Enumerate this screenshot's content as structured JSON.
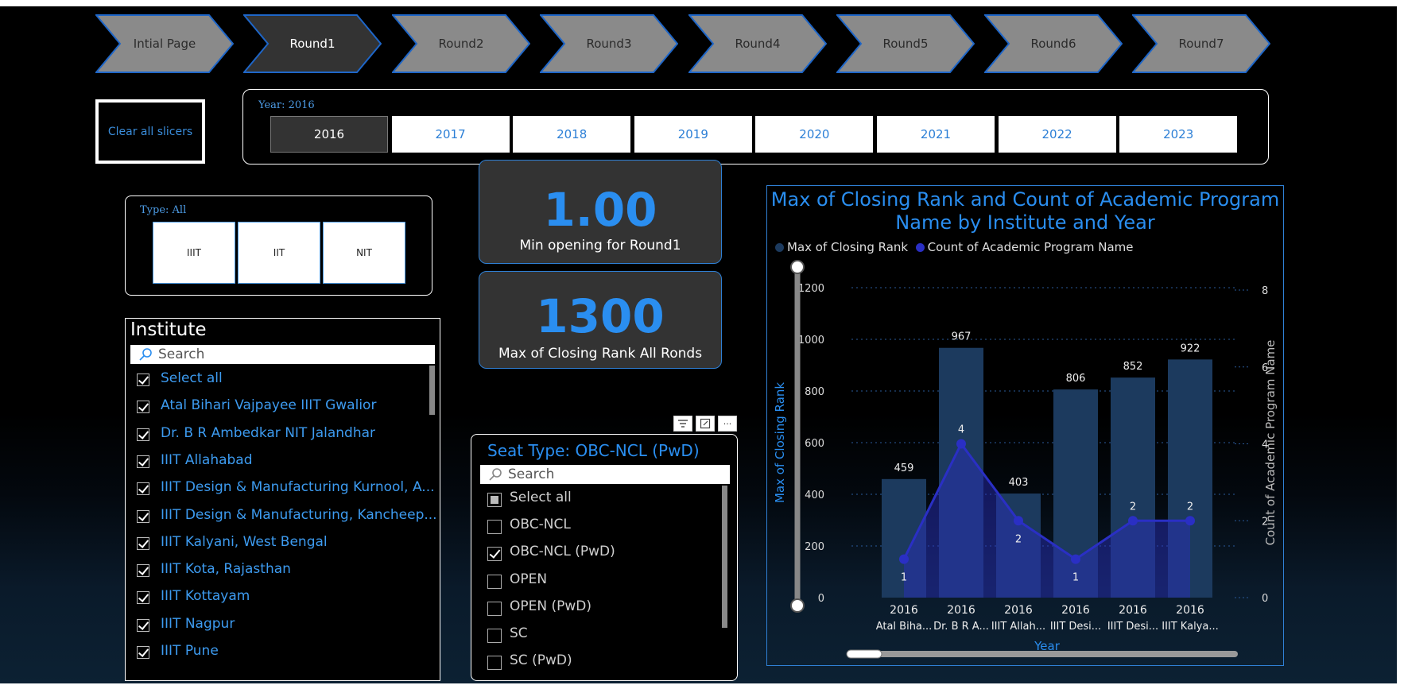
{
  "nav": {
    "steps": [
      {
        "label": "Intial Page",
        "active": false
      },
      {
        "label": "Round1",
        "active": true
      },
      {
        "label": "Round2",
        "active": false
      },
      {
        "label": "Round3",
        "active": false
      },
      {
        "label": "Round4",
        "active": false
      },
      {
        "label": "Round5",
        "active": false
      },
      {
        "label": "Round6",
        "active": false
      },
      {
        "label": "Round7",
        "active": false
      }
    ]
  },
  "clear_slicers": {
    "label": "Clear all slicers"
  },
  "year_slicer": {
    "title": "Year: 2016",
    "options": [
      "2016",
      "2017",
      "2018",
      "2019",
      "2020",
      "2021",
      "2022",
      "2023"
    ],
    "selected": "2016"
  },
  "type_slicer": {
    "title": "Type: All",
    "options": [
      "IIIT",
      "IIT",
      "NIT"
    ]
  },
  "cards": {
    "min_opening": {
      "value": "1.00",
      "label": "Min opening for Round1"
    },
    "max_closing": {
      "value": "1300",
      "label": "Max of Closing Rank All Ronds"
    }
  },
  "institute_slicer": {
    "title": "Institute",
    "search_placeholder": "Search",
    "items": [
      {
        "label": "Select all",
        "checked": true
      },
      {
        "label": "Atal Bihari Vajpayee IIIT Gwalior",
        "checked": true
      },
      {
        "label": "Dr. B R Ambedkar NIT Jalandhar",
        "checked": true
      },
      {
        "label": "IIIT Allahabad",
        "checked": true
      },
      {
        "label": "IIIT Design & Manufacturing Kurnool, A...",
        "checked": true
      },
      {
        "label": "IIIT Design & Manufacturing, Kancheep...",
        "checked": true
      },
      {
        "label": "IIIT Kalyani, West Bengal",
        "checked": true
      },
      {
        "label": "IIIT Kota, Rajasthan",
        "checked": true
      },
      {
        "label": "IIIT Kottayam",
        "checked": true
      },
      {
        "label": "IIIT Nagpur",
        "checked": true
      },
      {
        "label": "IIIT Pune",
        "checked": true
      }
    ]
  },
  "seat_slicer": {
    "title": "Seat Type: OBC-NCL (PwD)",
    "search_placeholder": "Search",
    "items": [
      {
        "label": "Select all",
        "state": "partial"
      },
      {
        "label": "OBC-NCL",
        "state": "off"
      },
      {
        "label": "OBC-NCL (PwD)",
        "state": "on"
      },
      {
        "label": "OPEN",
        "state": "off"
      },
      {
        "label": "OPEN (PwD)",
        "state": "off"
      },
      {
        "label": "SC",
        "state": "off"
      },
      {
        "label": "SC (PwD)",
        "state": "off"
      }
    ]
  },
  "visual_tools": {
    "filter_icon": "filter-icon",
    "focus_icon": "focus-mode-icon",
    "more": "···"
  },
  "chart_data": {
    "type": "bar",
    "title": "Max of Closing Rank and Count of Academic Program Name by Institute and Year",
    "legend": [
      "Max of Closing Rank",
      "Count of Academic Program Name"
    ],
    "categories": [
      "2016",
      "2016",
      "2016",
      "2016",
      "2016",
      "2016"
    ],
    "subcategories": [
      "Atal Biha...",
      "Dr. B R A...",
      "IIIT Allah...",
      "IIIT Desi...",
      "IIIT Desi...",
      "IIIT Kalya..."
    ],
    "series": [
      {
        "name": "Max of Closing Rank",
        "type": "bar",
        "axis": "left",
        "values": [
          459,
          967,
          403,
          806,
          852,
          922
        ],
        "color": "#1c3a5e"
      },
      {
        "name": "Count of Academic Program Name",
        "type": "line",
        "axis": "right",
        "values": [
          1,
          4,
          2,
          1,
          2,
          2
        ],
        "color": "#2a2fc4"
      }
    ],
    "xlabel": "Year",
    "ylabel": "Max of Closing Rank",
    "y2label": "Count of Academic Program Name",
    "ylim": [
      0,
      1200
    ],
    "yticks": [
      0,
      200,
      400,
      600,
      800,
      1000,
      1200
    ],
    "y2lim": [
      0,
      8
    ],
    "y2ticks": [
      0,
      2,
      4,
      6,
      8
    ],
    "grid": true,
    "legend_position": "top-left"
  },
  "colors": {
    "accent": "#2a8ef0",
    "chevron": "#8a8a8a",
    "chevron_active": "#333333",
    "chevron_border": "#1e66c8"
  }
}
